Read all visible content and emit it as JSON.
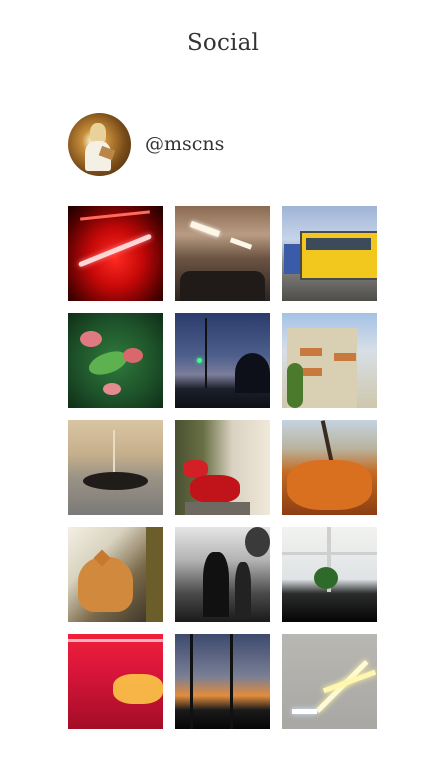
{
  "page": {
    "title": "Social"
  },
  "profile": {
    "handle": "@mscns"
  },
  "photos": [
    {
      "label": "photo-red-neon-sign"
    },
    {
      "label": "photo-train-interior"
    },
    {
      "label": "photo-yellow-tram"
    },
    {
      "label": "photo-red-flowers-leaves"
    },
    {
      "label": "photo-dusk-street"
    },
    {
      "label": "photo-building-ivy"
    },
    {
      "label": "photo-flowers-silhouette"
    },
    {
      "label": "photo-balcony-red-flowers"
    },
    {
      "label": "photo-autumn-tree"
    },
    {
      "label": "photo-cat-window"
    },
    {
      "label": "photo-people-walking-bw"
    },
    {
      "label": "photo-window-plant"
    },
    {
      "label": "photo-pink-corridor"
    },
    {
      "label": "photo-sunset-windows"
    },
    {
      "label": "photo-neon-light-tubes"
    }
  ]
}
